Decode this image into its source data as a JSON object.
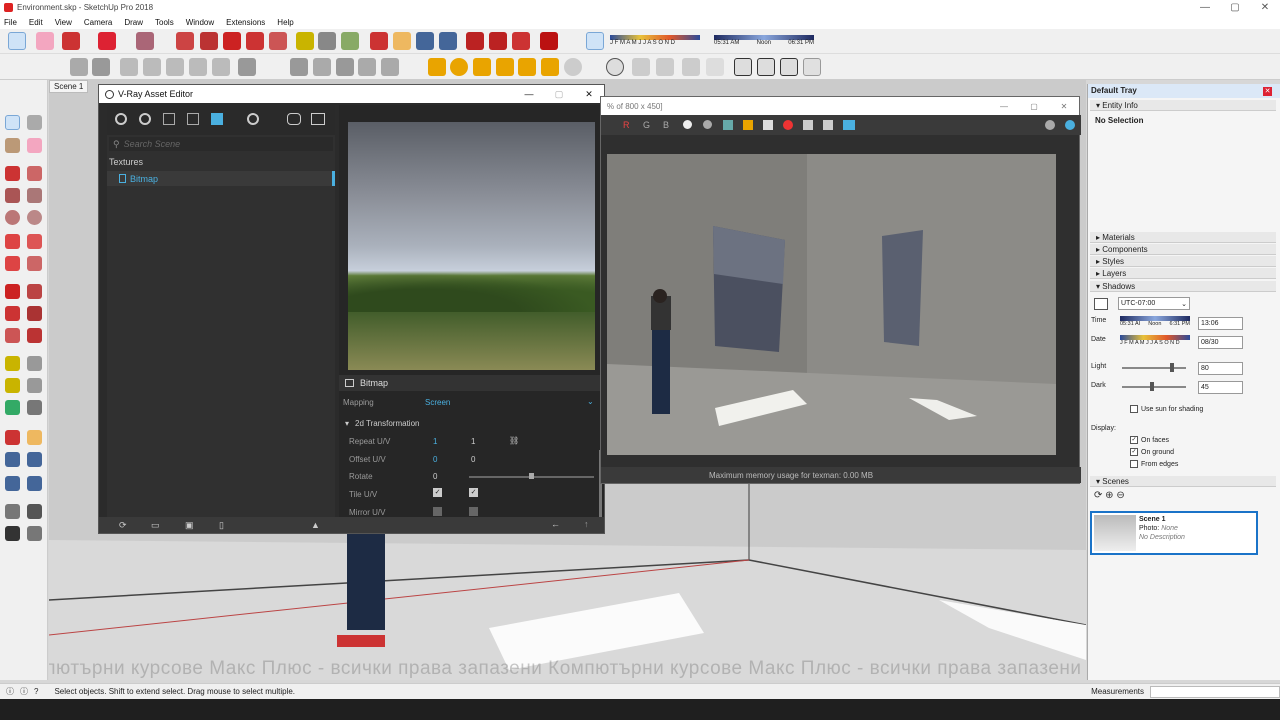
{
  "window": {
    "title": "Environment.skp - SketchUp Pro 2018",
    "min": "—",
    "max": "▢",
    "close": "✕"
  },
  "menu": [
    "File",
    "Edit",
    "View",
    "Camera",
    "Draw",
    "Tools",
    "Window",
    "Extensions",
    "Help"
  ],
  "shadow_toolbar": {
    "months": "J F M A M J J A S O N D",
    "time_start": "05:31 AM",
    "time_noon": "Noon",
    "time_end": "06:31 PM"
  },
  "scene_tab": "Scene 1",
  "asset_editor": {
    "title": "V-Ray Asset Editor",
    "search_placeholder": "Search Scene",
    "category": "Textures",
    "item": "Bitmap",
    "panel_title": "Bitmap",
    "mapping_label": "Mapping",
    "mapping_value": "Screen",
    "section": "2d Transformation",
    "repeat_label": "Repeat U/V",
    "repeat_u": "1",
    "repeat_v": "1",
    "offset_label": "Offset U/V",
    "offset_u": "0",
    "offset_v": "0",
    "rotate_label": "Rotate",
    "rotate_value": "0",
    "tile_label": "Tile U/V",
    "mirror_label": "Mirror U/V"
  },
  "frame_buffer": {
    "title": "% of 800 x 450]",
    "channels": [
      "R",
      "G",
      "B"
    ],
    "status": "Maximum memory usage for texman: 0.00 MB"
  },
  "tray": {
    "title": "Default Tray",
    "entity_info": "Entity Info",
    "no_selection": "No Selection",
    "panels": [
      "Materials",
      "Components",
      "Styles",
      "Layers",
      "Shadows"
    ],
    "timezone": "UTC-07:00",
    "time_label": "Time",
    "time_start": "05:31 AI",
    "time_noon": "Noon",
    "time_end": "6:31 PM",
    "time_value": "13:06",
    "date_label": "Date",
    "months": "J F M A M J J A S O N D",
    "date_value": "08/30",
    "light_label": "Light",
    "light_value": "80",
    "dark_label": "Dark",
    "dark_value": "45",
    "use_sun": "Use sun for shading",
    "display_label": "Display:",
    "on_faces": "On faces",
    "on_ground": "On ground",
    "from_edges": "From edges",
    "scenes": "Scenes",
    "scene_name": "Scene 1",
    "photo_label": "Photo:",
    "photo_value": "None",
    "description": "No Description"
  },
  "status": {
    "hint": "Select objects. Shift to extend select. Drag mouse to select multiple.",
    "measurements": "Measurements"
  },
  "watermark": "Компютърни курсове Макс Плюс - всички права запазени   Компютърни курсове Макс Плюс - всички права запазени",
  "colors": {
    "vray_accent": "#4ab0e0",
    "selection_blue": "#1a73c8"
  }
}
